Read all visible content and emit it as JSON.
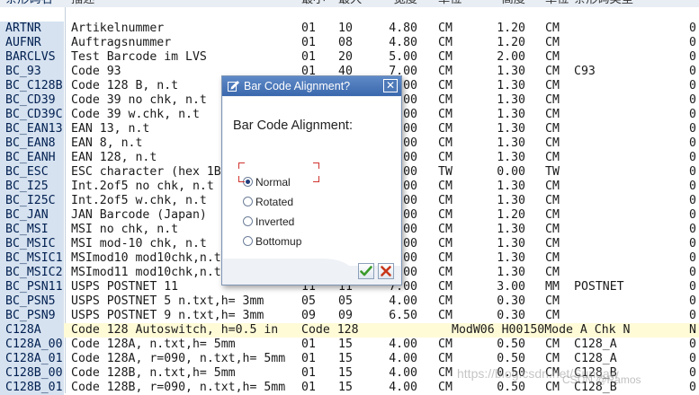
{
  "table": {
    "header": {
      "key": "条形码名",
      "desc": "描述",
      "n1": "最小",
      "n2": "最大",
      "pw": "宽度",
      "u1": "单位",
      "ht": "高度",
      "u2": "单位",
      "sub": "条形码类型"
    },
    "rows": [
      {
        "key": "ARTNR",
        "desc": "Artikelnummer",
        "n1": "01",
        "n2": "10",
        "pw": "4.80",
        "u1": "CM",
        "ht": "1.20",
        "u2": "CM",
        "sub": "",
        "last": "0"
      },
      {
        "key": "AUFNR",
        "desc": "Auftragsnummer",
        "n1": "01",
        "n2": "08",
        "pw": "4.80",
        "u1": "CM",
        "ht": "1.20",
        "u2": "CM",
        "sub": "",
        "last": "0"
      },
      {
        "key": "BARCLVS",
        "desc": "Test Barcode im LVS",
        "n1": "01",
        "n2": "20",
        "pw": "5.00",
        "u1": "CM",
        "ht": "2.00",
        "u2": "CM",
        "sub": "",
        "last": "0"
      },
      {
        "key": "BC_93",
        "desc": "Code 93",
        "n1": "01",
        "n2": "40",
        "pw": "7.00",
        "u1": "CM",
        "ht": "1.30",
        "u2": "CM",
        "sub": "C93",
        "last": "0"
      },
      {
        "key": "BC_C128B",
        "desc": "Code 128 B,      n.t",
        "n1": "",
        "n2": "",
        "pw": "00",
        "u1": "CM",
        "ht": "1.30",
        "u2": "CM",
        "sub": "",
        "last": "0"
      },
      {
        "key": "BC_CD39",
        "desc": "Code 39 no chk,   n.t",
        "n1": "",
        "n2": "",
        "pw": "00",
        "u1": "CM",
        "ht": "1.30",
        "u2": "CM",
        "sub": "",
        "last": "0"
      },
      {
        "key": "BC_CD39C",
        "desc": "Code 39 w.chk,    n.t",
        "n1": "",
        "n2": "",
        "pw": "00",
        "u1": "CM",
        "ht": "1.30",
        "u2": "CM",
        "sub": "",
        "last": "0"
      },
      {
        "key": "BC_EAN13",
        "desc": "EAN 13,          n.t",
        "n1": "",
        "n2": "",
        "pw": "00",
        "u1": "CM",
        "ht": "1.30",
        "u2": "CM",
        "sub": "",
        "last": "0"
      },
      {
        "key": "BC_EAN8",
        "desc": "EAN 8,           n.t",
        "n1": "",
        "n2": "",
        "pw": "00",
        "u1": "CM",
        "ht": "1.30",
        "u2": "CM",
        "sub": "",
        "last": "0"
      },
      {
        "key": "BC_EANH",
        "desc": "EAN 128,         n.t",
        "n1": "",
        "n2": "",
        "pw": "00",
        "u1": "CM",
        "ht": "1.30",
        "u2": "CM",
        "sub": "",
        "last": "0"
      },
      {
        "key": "BC_ESC",
        "desc": "ESC character (hex 1B",
        "n1": "",
        "n2": "",
        "pw": "00",
        "u1": "TW",
        "ht": "0.00",
        "u2": "TW",
        "sub": "",
        "last": "0"
      },
      {
        "key": "BC_I25",
        "desc": "Int.2of5 no chk,  n.t",
        "n1": "",
        "n2": "",
        "pw": "00",
        "u1": "CM",
        "ht": "1.30",
        "u2": "CM",
        "sub": "",
        "last": "0"
      },
      {
        "key": "BC_I25C",
        "desc": "Int.2of5 w.chk,   n.t",
        "n1": "",
        "n2": "",
        "pw": "00",
        "u1": "CM",
        "ht": "1.30",
        "u2": "CM",
        "sub": "",
        "last": "0"
      },
      {
        "key": "BC_JAN",
        "desc": "JAN Barcode (Japan)",
        "n1": "",
        "n2": "",
        "pw": "00",
        "u1": "CM",
        "ht": "1.20",
        "u2": "CM",
        "sub": "",
        "last": "0"
      },
      {
        "key": "BC_MSI",
        "desc": "MSI no chk,      n.t",
        "n1": "",
        "n2": "",
        "pw": "00",
        "u1": "CM",
        "ht": "1.30",
        "u2": "CM",
        "sub": "",
        "last": "0"
      },
      {
        "key": "BC_MSIC",
        "desc": "MSI mod-10 chk,  n.t",
        "n1": "",
        "n2": "",
        "pw": "00",
        "u1": "CM",
        "ht": "1.30",
        "u2": "CM",
        "sub": "",
        "last": "0"
      },
      {
        "key": "BC_MSIC1",
        "desc": "MSImod10 mod10chk,n.t",
        "n1": "",
        "n2": "",
        "pw": "00",
        "u1": "CM",
        "ht": "1.30",
        "u2": "CM",
        "sub": "",
        "last": "0"
      },
      {
        "key": "BC_MSIC2",
        "desc": "MSImod11 mod10chk,n.t",
        "n1": "",
        "n2": "",
        "pw": "00",
        "u1": "CM",
        "ht": "1.30",
        "u2": "CM",
        "sub": "",
        "last": "0"
      },
      {
        "key": "BC_PSN11",
        "desc": "USPS POSTNET 11",
        "n1": "11",
        "n2": "11",
        "pw": "7.00",
        "u1": "CM",
        "ht": "3.00",
        "u2": "MM",
        "sub": "POSTNET",
        "last": "0"
      },
      {
        "key": "BC_PSN5",
        "desc": "USPS POSTNET 5    n.txt,h= 3mm",
        "n1": "05",
        "n2": "05",
        "pw": "4.00",
        "u1": "CM",
        "ht": "0.30",
        "u2": "CM",
        "sub": "",
        "last": "0"
      },
      {
        "key": "BC_PSN9",
        "desc": "USPS POSTNET 9    n.txt,h= 3mm",
        "n1": "09",
        "n2": "09",
        "pw": "6.50",
        "u1": "CM",
        "ht": "0.30",
        "u2": "CM",
        "sub": "",
        "last": "0"
      },
      {
        "key": "C128A",
        "desc": "Code 128 Autoswitch, h=0.5 in",
        "n1": "Code 128",
        "n2": "",
        "pw": "",
        "u1": "ModW06 H00150Mode A Chk N",
        "ht": "",
        "u2": "",
        "sub": "",
        "last": "N"
      },
      {
        "key": "C128A_00",
        "desc": "Code 128A,        n.txt,h= 5mm",
        "n1": "01",
        "n2": "15",
        "pw": "4.00",
        "u1": "CM",
        "ht": "0.50",
        "u2": "CM",
        "sub": "C128_A",
        "last": "0"
      },
      {
        "key": "C128A_01",
        "desc": "Code 128A,  r=090, n.txt,h= 5mm",
        "n1": "01",
        "n2": "15",
        "pw": "4.00",
        "u1": "CM",
        "ht": "0.50",
        "u2": "CM",
        "sub": "C128_A",
        "last": "0"
      },
      {
        "key": "C128B_00",
        "desc": "Code 128B,        n.txt,h= 5mm",
        "n1": "01",
        "n2": "15",
        "pw": "4.00",
        "u1": "CM",
        "ht": "0.50",
        "u2": "CM",
        "sub": "C128_B",
        "last": "0"
      },
      {
        "key": "C128B_01",
        "desc": "Code 128B,  r=090, n.txt,h= 5mm",
        "n1": "01",
        "n2": "15",
        "pw": "4.00",
        "u1": "CM",
        "ht": "0.50",
        "u2": "CM",
        "sub": "C128_B",
        "last": "0"
      }
    ]
  },
  "dialog": {
    "title": "Bar Code Alignment?",
    "question": "Bar Code Alignment:",
    "options": [
      {
        "label": "Normal",
        "checked": true
      },
      {
        "label": "Rotated",
        "checked": false
      },
      {
        "label": "Inverted",
        "checked": false
      },
      {
        "label": "Bottomup",
        "checked": false
      }
    ],
    "close_icon": "close-icon",
    "ok_icon": "checkmark-icon",
    "cancel_icon": "cancel-icon"
  },
  "watermark": {
    "text": "https://blog.csdn.net/Sundaw",
    "credit": "CSDN @Ramos"
  },
  "colors": {
    "key_column": "#d6e2f0",
    "highlight_row": "#fffbd7",
    "dialog_title": "#3a68ad",
    "ok_green": "#3a9a2b",
    "cancel_red": "#c8361a"
  }
}
